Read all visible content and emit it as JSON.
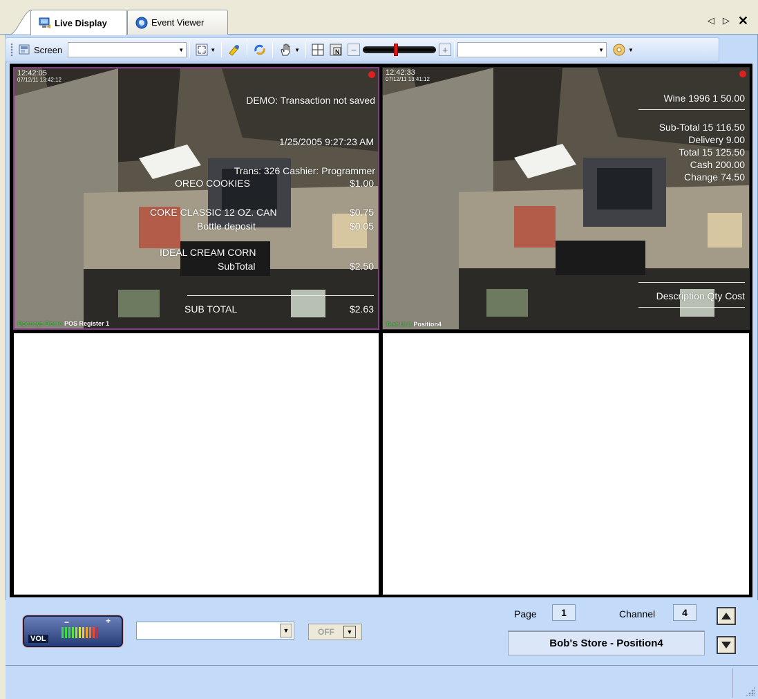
{
  "tabs": [
    {
      "label": "Live Display",
      "active": true,
      "icon": "live-display-icon"
    },
    {
      "label": "Event Viewer",
      "active": false,
      "icon": "event-viewer-icon"
    }
  ],
  "tab_controls": {
    "prev": "◁",
    "next": "▷",
    "close": "✕"
  },
  "toolbar": {
    "screen_label": "Screen",
    "screen_value": "",
    "camera_value": "",
    "icons": [
      "screen-icon",
      "fullscreen-icon",
      "pan-icon",
      "refresh-icon",
      "hand-icon",
      "quad-layout-icon",
      "n-layout-icon",
      "zoom-out-icon",
      "zoom-slider",
      "zoom-in-icon",
      "disc-icon"
    ],
    "zoom_level": 0.45,
    "zoom_minus": "−",
    "zoom_plus": "+"
  },
  "cameras": [
    {
      "time": "12:42:05",
      "date": "07/12/11 13:42:12",
      "label_prefix": "Openeye Demo",
      "label": "POS Register 1",
      "overlay": [
        {
          "text": "DEMO: Transaction not saved"
        },
        {
          "text": "1/25/2005 9:27:23 AM"
        },
        {
          "text": "Trans: 326    Cashier: Programmer"
        },
        {
          "text": "OREO COOKIES",
          "amount": "$1.00"
        },
        {
          "text": "COKE CLASSIC 12 OZ. CAN",
          "amount": "$0.75"
        },
        {
          "text": "Bottle deposit",
          "amount": "$0.05"
        },
        {
          "text": "IDEAL CREAM CORN",
          "amount": ""
        },
        {
          "text": "SubTotal",
          "amount": "$2.50"
        },
        {
          "text": "SUB TOTAL",
          "amount": "$2.63"
        }
      ]
    },
    {
      "time": "12:42:33",
      "date": "07/12/11 13:41:12",
      "label_prefix": "Test Unit",
      "label": "Position4",
      "overlay": [
        {
          "text": "Wine 1996   1   50.00"
        },
        {
          "text": "Sub-Total  15 116.50"
        },
        {
          "text": "Delivery      9.00"
        },
        {
          "text": "Total  15 125.50"
        },
        {
          "text": "Cash    200.00"
        },
        {
          "text": "Change    74.50"
        },
        {
          "text": "Description Qty Cost"
        }
      ]
    }
  ],
  "bottom": {
    "vol_label": "VOL",
    "vol_minus": "−",
    "vol_plus": "+",
    "audio_value": "",
    "off_label": "OFF",
    "page_label": "Page",
    "page_value": "1",
    "channel_label": "Channel",
    "channel_value": "4",
    "store_name": "Bob's Store - Position4"
  },
  "colors": {
    "frame_bg": "#c3daf9",
    "active_cell_border": "#8b3a8b",
    "record_dot": "#e02020"
  }
}
